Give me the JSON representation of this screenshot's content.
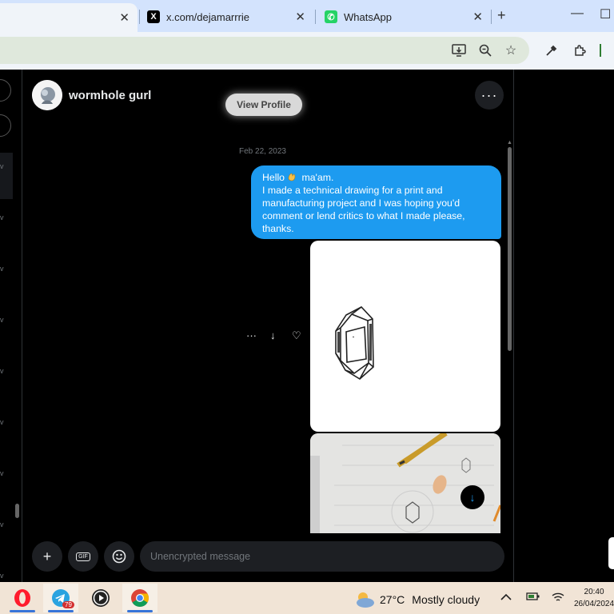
{
  "browser": {
    "tabs": [
      {
        "label": "",
        "close": "✕"
      },
      {
        "label": "x.com/dejamarrrie",
        "close": "✕",
        "favicon": "x-logo-icon"
      },
      {
        "label": "WhatsApp",
        "close": "✕",
        "favicon": "whatsapp-icon"
      }
    ],
    "new_tab": "+",
    "window_controls": {
      "minimize": "—",
      "maximize": "☐"
    }
  },
  "chat": {
    "contact_name": "wormhole gurl",
    "view_profile": "View Profile",
    "more": "···",
    "date": "Feb 22, 2023",
    "message": {
      "greeting_before": "Hello",
      "greeting_after": " ma'am.",
      "lines": [
        "I made a technical drawing for a print and",
        "manufacturing project and I was hoping you'd",
        "comment or lend critics to what I made please,",
        "thanks."
      ]
    },
    "actions": {
      "more": "···",
      "download": "↓",
      "react": "♡"
    },
    "composer": {
      "placeholder": "Unencrypted message",
      "add": "+",
      "gif": "GIF"
    }
  },
  "taskbar": {
    "telegram_badge": "79",
    "weather": {
      "temp": "27°C",
      "condition": "Mostly cloudy"
    },
    "clock": {
      "time": "20:40",
      "date": "26/04/2024"
    }
  },
  "colors": {
    "accent": "#1d9bf0",
    "chat_bg": "#000000",
    "tab_strip": "#d3e3fd"
  }
}
